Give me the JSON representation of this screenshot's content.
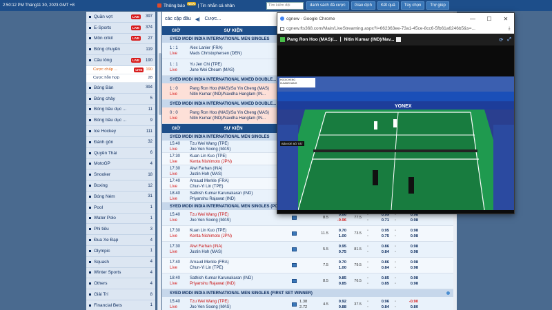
{
  "topbar": {
    "time": "2:50:12 PM Tháng11 30, 2023 GMT +8",
    "notice": "Thông báo",
    "notice_badge": "NEW",
    "personal": "Tin nhắn cá nhân",
    "search_placeholder": "Tìm kiếm đội",
    "buttons": [
      "danh sách đã cược",
      "Giao dịch",
      "Kết quả",
      "Tùy chọn",
      "Trợ giúp"
    ]
  },
  "sidebar": {
    "items": [
      {
        "label": "Quần vợt",
        "live": "LIVE",
        "count": "397"
      },
      {
        "label": "E-Sports",
        "live": "LIVE",
        "count": "374"
      },
      {
        "label": "Môn crikil",
        "live": "LIVE",
        "count": "27"
      },
      {
        "label": "Bóng chuyền",
        "live": "",
        "count": "119"
      },
      {
        "label": "Cầu lông",
        "live": "LIVE",
        "count": "190"
      }
    ],
    "subitems": [
      {
        "label": "Cược chấp ...",
        "live": "LIVE",
        "count": "190",
        "active": true
      },
      {
        "label": "Cược hỗn hợp",
        "live": "",
        "count": "28",
        "active": false
      }
    ],
    "items2": [
      {
        "label": "Bóng Bàn",
        "count": "394"
      },
      {
        "label": "Bóng chày",
        "count": "5"
      },
      {
        "label": "Bóng bầu dục ...",
        "count": "11"
      },
      {
        "label": "Bóng bầu dục ...",
        "count": "9"
      },
      {
        "label": "Ice Hockey",
        "count": "111"
      },
      {
        "label": "Đánh gôn",
        "count": "32"
      },
      {
        "label": "Quyền Thái",
        "count": "6"
      },
      {
        "label": "MotoGP",
        "count": "4"
      },
      {
        "label": "Snooker",
        "count": "18"
      },
      {
        "label": "Boxing",
        "count": "12"
      },
      {
        "label": "Bóng Ném",
        "count": "31"
      },
      {
        "label": "Pool",
        "count": "1"
      },
      {
        "label": "Water Polo",
        "count": "1"
      },
      {
        "label": "Phi tiêu",
        "count": "3"
      },
      {
        "label": "Đua Xe Đạp",
        "count": "4"
      },
      {
        "label": "Olympic",
        "count": "1"
      },
      {
        "label": "Squash",
        "count": "4"
      },
      {
        "label": "Winter Sports",
        "count": "4"
      },
      {
        "label": "Others",
        "count": "4"
      },
      {
        "label": "Giải Trí",
        "count": "8"
      },
      {
        "label": "Financial Bets",
        "count": "1"
      }
    ]
  },
  "main": {
    "tab_label": "các cập đầu",
    "tab_sub": "Cược...",
    "col_time": "GIỜ",
    "col_event": "SỰ KIỆN",
    "live_section": [
      {
        "league": "SYED MODI INDIA INTERNATIONAL MEN SINGLES",
        "rows": [
          {
            "score": "1 : 1",
            "status": "Live",
            "t1": "Alex Lanier (FRA)",
            "t2": "Mads Christophersen (DEN)",
            "red": false
          },
          {
            "score": "1 : 1",
            "status": "Live",
            "t1": "Yu Jen Chi (TPE)",
            "t2": "June Wei Cheam (MAS)",
            "red": false
          }
        ]
      },
      {
        "league": "SYED MODI INDIA INTERNATIONAL MIXED DOUBLE...",
        "rows": [
          {
            "score": "1 : 0",
            "status": "Live",
            "t1": "Pang Ron Hoo (MAS)/Su Yin Cheng (MAS)",
            "t2": "Nitin Kumar (IND)/Navdha Hanglam (IN...",
            "red": true
          }
        ]
      },
      {
        "league": "SYED MODI INDIA INTERNATIONAL MIXED DOUBLE...",
        "rows": [
          {
            "score": "0 : 0",
            "status": "Live",
            "t1": "Pang Ron Hoo (MAS)/Su Yin Cheng (MAS)",
            "t2": "Nitin Kumar (IND)/Navdha Hanglam (IN...",
            "red": true
          }
        ]
      }
    ],
    "sched_league": "SYED MODI INDIA INTERNATIONAL MEN SINGLES",
    "sched_rows": [
      {
        "time": "15:40",
        "status": "Live",
        "t1": "Tzu Wei Wang (TPE)",
        "t2": "Joo Ven Soong (MAS)",
        "fav": 0
      },
      {
        "time": "17:30",
        "status": "Live",
        "t1": "Kuan Lin Kuo (TPE)",
        "t2": "Kenta Nishimoto (JPN)",
        "fav": 2
      },
      {
        "time": "17:30",
        "status": "Live",
        "t1": "Alwi Farhan (INA)",
        "t2": "Justin Hoh (MAS)",
        "fav": 0
      },
      {
        "time": "17:40",
        "status": "Live",
        "t1": "Arnaud Merkle (FRA)",
        "t2": "Chun-Yi Lin (TPE)",
        "fav": 0
      },
      {
        "time": "18:40",
        "status": "Live",
        "t1": "Sathish Kumar Karunakaran (IND)",
        "t2": "Priyanshu Rajawat (IND)",
        "fav": 0
      }
    ],
    "hcp_league": "SYED MODI INDIA INTERNATIONAL MEN SINGLES (POINT HANDICAP)",
    "hcp_rows": [
      {
        "time": "15:40",
        "status": "Live",
        "t1": "Tzu Wei Wang (TPE)",
        "t2": "Joo Ven Soong (MAS)",
        "fav": 1,
        "o1a": "",
        "o1b": "",
        "o2a": "8.5",
        "o2b": "",
        "o3a": "0.66",
        "o3b": "-0.96",
        "o4a": "77.5",
        "o4b": "",
        "o6a": "0.99",
        "o6b": "0.71",
        "o8a": "0.98",
        "o8b": "0.98"
      },
      {
        "time": "17:30",
        "status": "Live",
        "t1": "Kuan Lin Kuo (TPE)",
        "t2": "Kenta Nishimoto (JPN)",
        "fav": 2,
        "o1a": "",
        "o1b": "",
        "o2a": "",
        "o2b": "11.5",
        "o3a": "0.70",
        "o3b": "1.00",
        "o4a": "73.5",
        "o4b": "",
        "o6a": "0.95",
        "o6b": "0.75",
        "o8a": "0.98",
        "o8b": "0.98"
      },
      {
        "time": "17:30",
        "status": "Live",
        "t1": "Alwi Farhan (INA)",
        "t2": "Justin Hoh (MAS)",
        "fav": 1,
        "o1a": "",
        "o1b": "",
        "o2a": "5.5",
        "o2b": "",
        "o3a": "0.95",
        "o3b": "0.75",
        "o4a": "81.5",
        "o4b": "",
        "o6a": "0.86",
        "o6b": "0.84",
        "o8a": "0.98",
        "o8b": "0.98"
      },
      {
        "time": "17:40",
        "status": "Live",
        "t1": "Arnaud Merkle (FRA)",
        "t2": "Chun-Yi Lin (TPE)",
        "fav": 0,
        "o1a": "",
        "o1b": "",
        "o2a": "",
        "o2b": "7.5",
        "o3a": "0.70",
        "o3b": "1.00",
        "o4a": "79.5",
        "o4b": "",
        "o6a": "0.86",
        "o6b": "0.84",
        "o8a": "0.98",
        "o8b": "0.98"
      },
      {
        "time": "18:40",
        "status": "Live",
        "t1": "Sathish Kumar Karunakaran (IND)",
        "t2": "Priyanshu Rajawat (IND)",
        "fav": 2,
        "o1a": "",
        "o1b": "",
        "o2a": "",
        "o2b": "8.5",
        "o3a": "0.85",
        "o3b": "0.85",
        "o4a": "76.5",
        "o4b": "",
        "o6a": "0.85",
        "o6b": "0.85",
        "o8a": "0.98",
        "o8b": "0.98"
      }
    ],
    "fs_league": "SYED MODI INDIA INTERNATIONAL MEN SINGLES (FIRST SET WINNER)",
    "fs_rows": [
      {
        "time": "15:40",
        "status": "Live",
        "t1": "Tzu Wei Wang (TPE)",
        "t2": "Joo Ven Soong (MAS)",
        "fav": 1,
        "o1a": "1.38",
        "o1b": "2.72",
        "o2a": "4.5",
        "o2b": "",
        "o3a": "0.92",
        "o3b": "0.88",
        "o4a": "37.5",
        "o4b": "",
        "o6a": "0.96",
        "o6b": "0.84",
        "o8a": "-0.90",
        "o8b": "0.80"
      }
    ]
  },
  "chrome": {
    "title": "cgnew - Google Chrome",
    "url": "cgnew.fts368.com/Main/LiveStreaming.aspx?i=662363ee-73a1-45ce-8cc6-5fb61a6246b5&s=...",
    "team1": "Pang Ron Hoo (MAS)/...",
    "team2": "Nitin Kumar (IND)/Nav...",
    "score_line1": "HOO/CHENG",
    "score_line2": "KUMAR/HANG",
    "badge": "BẤM ĐỂ BỎ TẮT",
    "brand": "YONEX",
    "colors": {
      "court": "#1f9a4f",
      "court_dark": "#187c3f",
      "board": "#1d3d9a"
    }
  }
}
